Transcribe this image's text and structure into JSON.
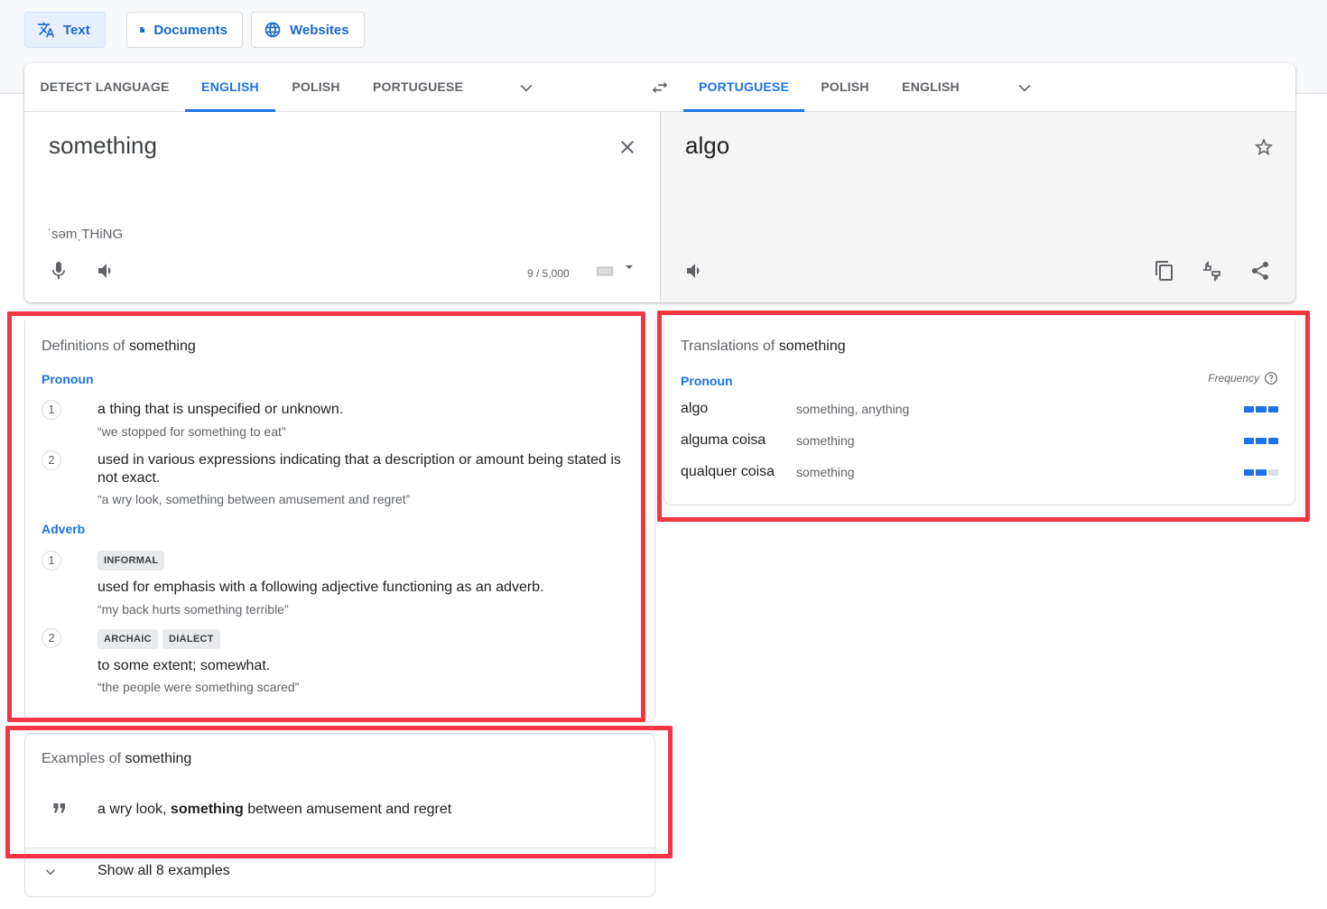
{
  "modes": [
    {
      "label": "Text",
      "icon": "translate-icon",
      "active": true
    },
    {
      "label": "Documents",
      "icon": "document-icon",
      "active": false
    },
    {
      "label": "Websites",
      "icon": "globe-icon",
      "active": false
    }
  ],
  "source": {
    "tabs": [
      "DETECT LANGUAGE",
      "ENGLISH",
      "POLISH",
      "PORTUGUESE"
    ],
    "active_tab": "ENGLISH",
    "text": "something",
    "phonetic": "ˈsəmˌTHiNG",
    "char_count": "9 / 5,000"
  },
  "target": {
    "tabs": [
      "PORTUGUESE",
      "POLISH",
      "ENGLISH"
    ],
    "active_tab": "PORTUGUESE",
    "text": "algo"
  },
  "definitions": {
    "title_prefix": "Definitions of",
    "word": "something",
    "groups": [
      {
        "pos": "Pronoun",
        "items": [
          {
            "n": "1",
            "tags": [],
            "definition": "a thing that is unspecified or unknown.",
            "example": "“we stopped for something to eat”"
          },
          {
            "n": "2",
            "tags": [],
            "definition": "used in various expressions indicating that a description or amount being stated is not exact.",
            "example": "“a wry look, something between amusement and regret”"
          }
        ]
      },
      {
        "pos": "Adverb",
        "items": [
          {
            "n": "1",
            "tags": [
              "INFORMAL"
            ],
            "definition": "used for emphasis with a following adjective functioning as an adverb.",
            "example": "“my back hurts something terrible”"
          },
          {
            "n": "2",
            "tags": [
              "ARCHAIC",
              "DIALECT"
            ],
            "definition": "to some extent; somewhat.",
            "example": "“the people were something scared”"
          }
        ]
      }
    ]
  },
  "translations": {
    "title_prefix": "Translations of",
    "word": "something",
    "pos": "Pronoun",
    "frequency_label": "Frequency",
    "rows": [
      {
        "word": "algo",
        "back": "something, anything",
        "frequency": 3
      },
      {
        "word": "alguma coisa",
        "back": "something",
        "frequency": 3
      },
      {
        "word": "qualquer coisa",
        "back": "something",
        "frequency": 2
      }
    ],
    "frequency_max": 3
  },
  "examples": {
    "title_prefix": "Examples of",
    "word": "something",
    "sentence_before": "a wry look, ",
    "sentence_bold": "something",
    "sentence_after": " between amusement and regret",
    "show_all": "Show all 8 examples"
  },
  "colors": {
    "accent": "#1a73e8",
    "highlight_box": "#f23645"
  }
}
